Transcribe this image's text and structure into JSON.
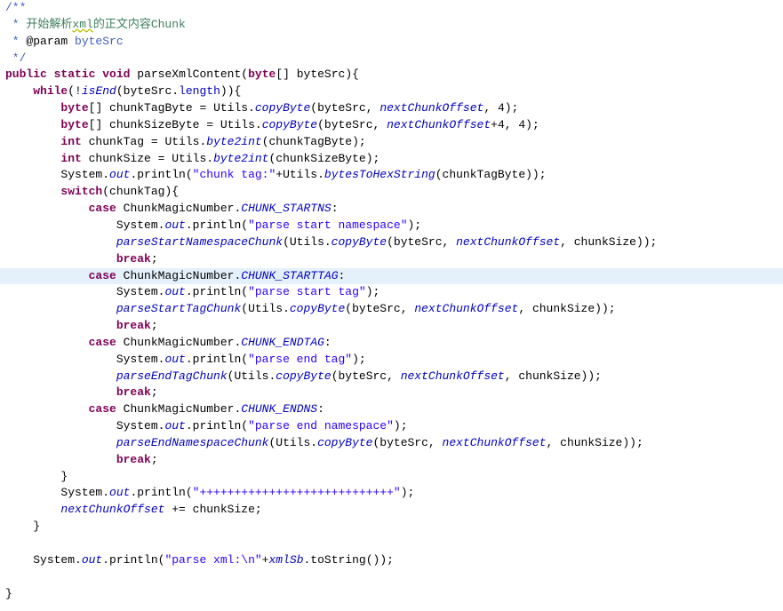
{
  "doc": {
    "open": "/**",
    "line1_star": " *",
    "line1_text": " 开始解析",
    "line1_xml": "xml",
    "line1_text2": "的正文内容Chunk",
    "param_star": " *",
    "param_tag": " @param",
    "param_name": " byteSrc",
    "close": " */"
  },
  "code": {
    "kw_public": "public",
    "kw_static": "static",
    "kw_void": "void",
    "fn_name": " parseXmlContent(",
    "kw_byte": "byte",
    "arr_param": "[] byteSrc){",
    "kw_while": "while",
    "while_open": "(!",
    "fn_isEnd": "isEnd",
    "while_args_open": "(byteSrc.",
    "fld_length": "length",
    "while_close": ")){",
    "kw_byte2": "byte",
    "l3_a": "[] chunkTagByte = Utils.",
    "fn_copyByte": "copyByte",
    "l3_b": "(byteSrc, ",
    "var_nextOffset": "nextChunkOffset",
    "l3_c": ", 4);",
    "kw_byte3": "byte",
    "l4_a": "[] chunkSizeByte = Utils.",
    "l4_plus4": "+4, 4);",
    "kw_int": "int",
    "l5_a": " chunkTag = Utils.",
    "fn_byte2int": "byte2int",
    "l5_b": "(chunkTagByte);",
    "kw_int2": "int",
    "l6_a": " chunkSize = Utils.",
    "l6_b": "(chunkSizeByte);",
    "sys": "System.",
    "out": "out",
    "println_open": ".println(",
    "str_chunk_tag": "\"chunk tag:\"",
    "l7_mid": "+Utils.",
    "fn_bytesToHex": "bytesToHexString",
    "l7_end": "(chunkTagByte));",
    "kw_switch": "switch",
    "switch_arg": "(chunkTag){",
    "kw_case": "case",
    "case1_pre": " ChunkMagicNumber.",
    "const_startns": "CHUNK_STARTNS",
    "colon": ":",
    "str_start_ns": "\"parse start namespace\"",
    "paren_close_semi": ");",
    "fn_parseStartNs": "parseStartNamespaceChunk",
    "inner_open": "(Utils.",
    "inner_args_open": "(byteSrc, ",
    "inner_args_close": ", chunkSize));",
    "kw_break": "break",
    "semi": ";",
    "const_starttag": "CHUNK_STARTTAG",
    "str_start_tag": "\"parse start tag\"",
    "fn_parseStartTag": "parseStartTagChunk",
    "const_endtag": "CHUNK_ENDTAG",
    "str_end_tag": "\"parse end tag\"",
    "fn_parseEndTag": "parseEndTagChunk",
    "const_endns": "CHUNK_ENDNS",
    "str_end_ns": "\"parse end namespace\"",
    "fn_parseEndNs": "parseEndNamespaceChunk",
    "close_brace": "}",
    "str_pluses": "\"++++++++++++++++++++++++++++\"",
    "incr_a": "",
    "incr_op": " += chunkSize;",
    "str_parse_xml": "\"parse xml:\\n\"",
    "plus": "+",
    "var_xmlSb": "xmlSb",
    "toString": ".toString());"
  }
}
